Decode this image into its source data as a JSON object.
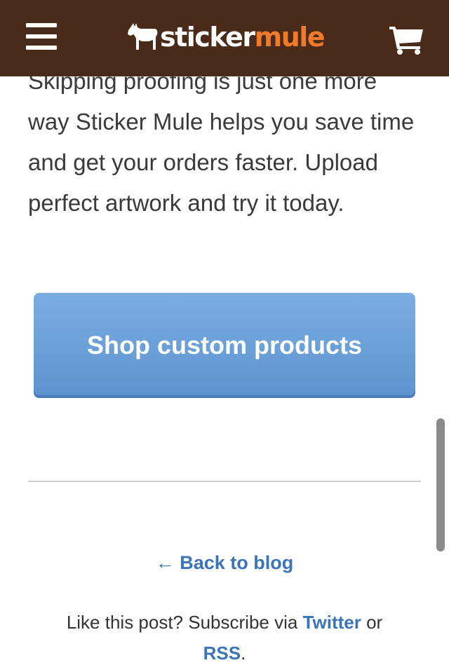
{
  "header": {
    "logo_part1": "sticker",
    "logo_part2": "mule",
    "menu_icon": "hamburger-menu-icon",
    "cart_icon": "shopping-cart-icon",
    "background_color": "#4a2a18",
    "logo_accent_color": "#f07a2c"
  },
  "article": {
    "paragraph": "Skipping proofing is just one more way Sticker Mule helps you save time and get your orders faster. Upload perfect artwork and try it today."
  },
  "cta": {
    "label": "Shop custom products",
    "color": "#6a9fd8"
  },
  "footer": {
    "back_link": "← Back to blog",
    "subscribe_prefix": "Like this post? Subscribe via ",
    "twitter_label": "Twitter",
    "subscribe_middle": " or",
    "rss_label": "RSS",
    "subscribe_suffix": ".",
    "link_color": "#3b74b8"
  }
}
